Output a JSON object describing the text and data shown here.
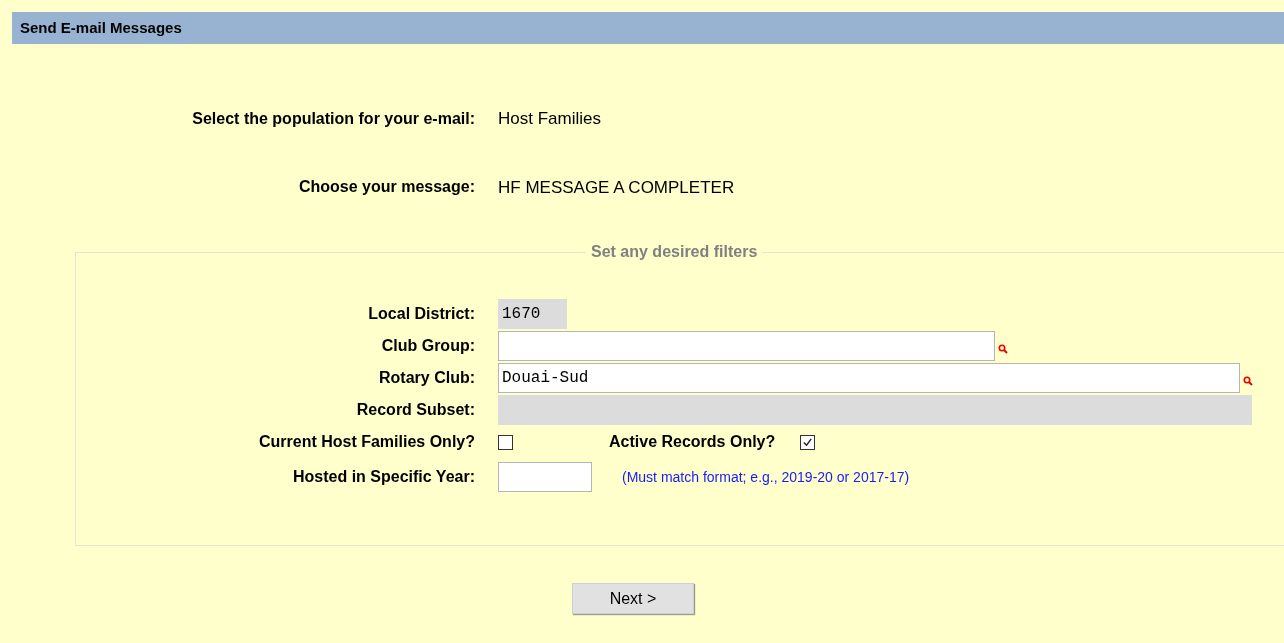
{
  "header": {
    "title": "Send E-mail Messages"
  },
  "summary": [
    {
      "label": "Select the population for your e-mail:",
      "value": "Host Families"
    },
    {
      "label": "Choose your message:",
      "value": "HF MESSAGE A COMPLETER"
    }
  ],
  "filters": {
    "legend": "Set any desired filters",
    "fields": [
      {
        "kind": "text",
        "label": "Local District:",
        "value": "1670",
        "readonly": true,
        "search": false
      },
      {
        "kind": "text",
        "label": "Club Group:",
        "readonly": false,
        "search": true
      },
      {
        "kind": "text",
        "label": "Rotary Club:",
        "value": "Douai-Sud",
        "readonly": false,
        "search": true
      },
      {
        "kind": "text",
        "label": "Record Subset:",
        "readonly": true,
        "search": false
      },
      {
        "kind": "checkboxes",
        "label": "Current Host Families Only?",
        "checked": false,
        "second_label": "Active Records Only?",
        "second_checked": true
      },
      {
        "kind": "text",
        "label": "Hosted in Specific Year:",
        "readonly": false,
        "search": false,
        "hint": "(Must match format; e.g., 2019-20 or 2017-17)"
      }
    ]
  },
  "button": "Next >"
}
